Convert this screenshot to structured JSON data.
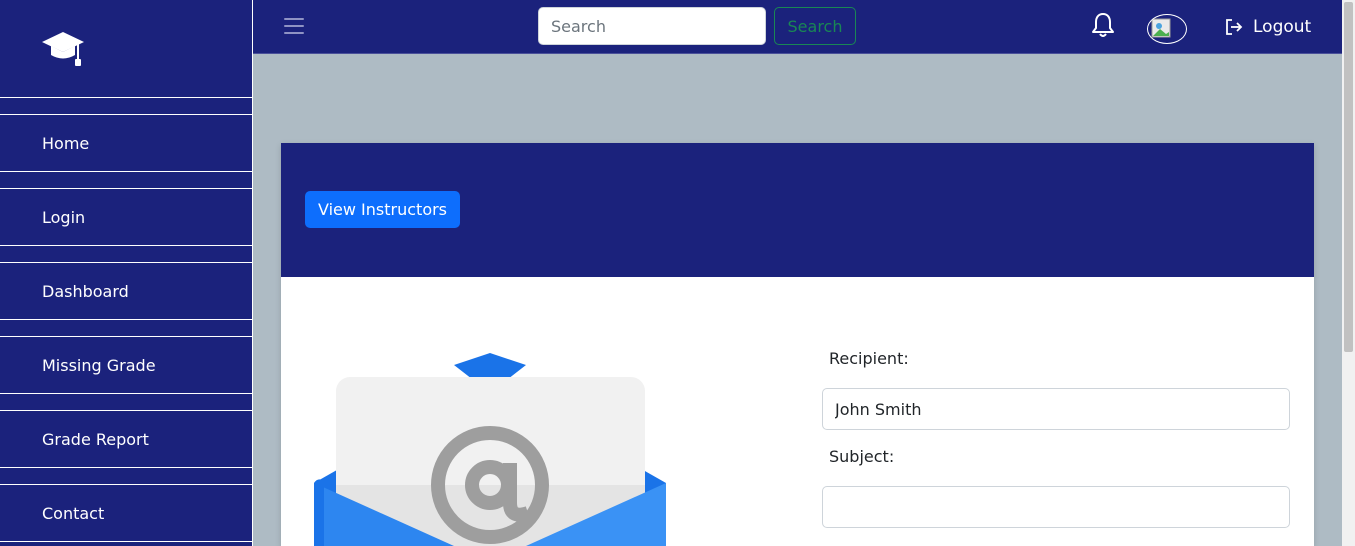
{
  "sidebar": {
    "logo_icon": "graduation-cap-icon",
    "items": [
      {
        "label": "Home"
      },
      {
        "label": "Login"
      },
      {
        "label": "Dashboard"
      },
      {
        "label": "Missing Grade"
      },
      {
        "label": "Grade Report"
      },
      {
        "label": "Contact"
      }
    ]
  },
  "topbar": {
    "search_placeholder": "Search",
    "search_button": "Search",
    "logout_label": "Logout"
  },
  "card": {
    "view_instructors_label": "View Instructors",
    "recipient_label": "Recipient:",
    "recipient_value": "John Smith",
    "subject_label": "Subject:",
    "subject_value": ""
  },
  "colors": {
    "primary": "#1b227c",
    "button_blue": "#0d6efd",
    "search_green": "#198754",
    "page_bg": "#aebbc4"
  }
}
